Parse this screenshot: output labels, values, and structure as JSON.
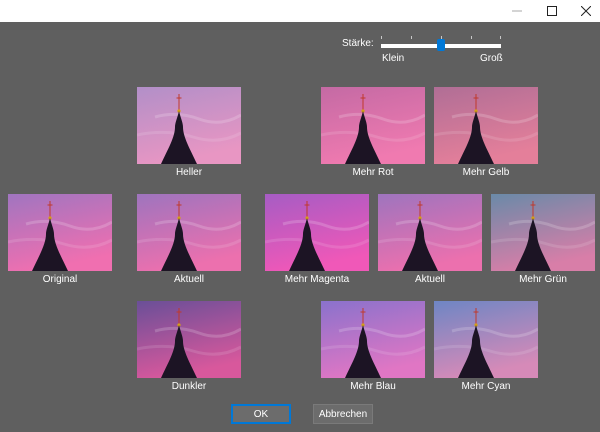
{
  "window": {
    "min_icon": "minimize-icon",
    "max_icon": "maximize-icon",
    "close_icon": "close-icon"
  },
  "strength": {
    "label": "Stärke:",
    "min_label": "Klein",
    "max_label": "Groß",
    "value": 0.5
  },
  "variants": [
    {
      "name": "Heller",
      "sky_top": "#b28fc8",
      "sky_bottom": "#e896c3"
    },
    {
      "name": "Mehr Rot",
      "sky_top": "#c46aa4",
      "sky_bottom": "#f07ab0"
    },
    {
      "name": "Mehr Gelb",
      "sky_top": "#b06e96",
      "sky_bottom": "#e47f9a"
    },
    {
      "name": "Original",
      "sky_top": "#a075c0",
      "sky_bottom": "#f06fb0"
    },
    {
      "name": "Aktuell",
      "sky_top": "#9e74be",
      "sky_bottom": "#ec70ae"
    },
    {
      "name": "Mehr Magenta",
      "sky_top": "#a65cc4",
      "sky_bottom": "#f058b8"
    },
    {
      "name": "Aktuell",
      "sky_top": "#9e74be",
      "sky_bottom": "#ec70ae"
    },
    {
      "name": "Mehr Grün",
      "sky_top": "#6a8aa8",
      "sky_bottom": "#d87ea8"
    },
    {
      "name": "Dunkler",
      "sky_top": "#6a4f98",
      "sky_bottom": "#d8589c"
    },
    {
      "name": "Mehr Blau",
      "sky_top": "#8a72cc",
      "sky_bottom": "#e076c4"
    },
    {
      "name": "Mehr Cyan",
      "sky_top": "#6e86c4",
      "sky_bottom": "#d68ab8"
    }
  ],
  "buttons": {
    "ok": "OK",
    "cancel": "Abbrechen"
  },
  "colors": {
    "background": "#5f5f5f",
    "accent": "#0078d7",
    "spire": "#1c1424"
  }
}
